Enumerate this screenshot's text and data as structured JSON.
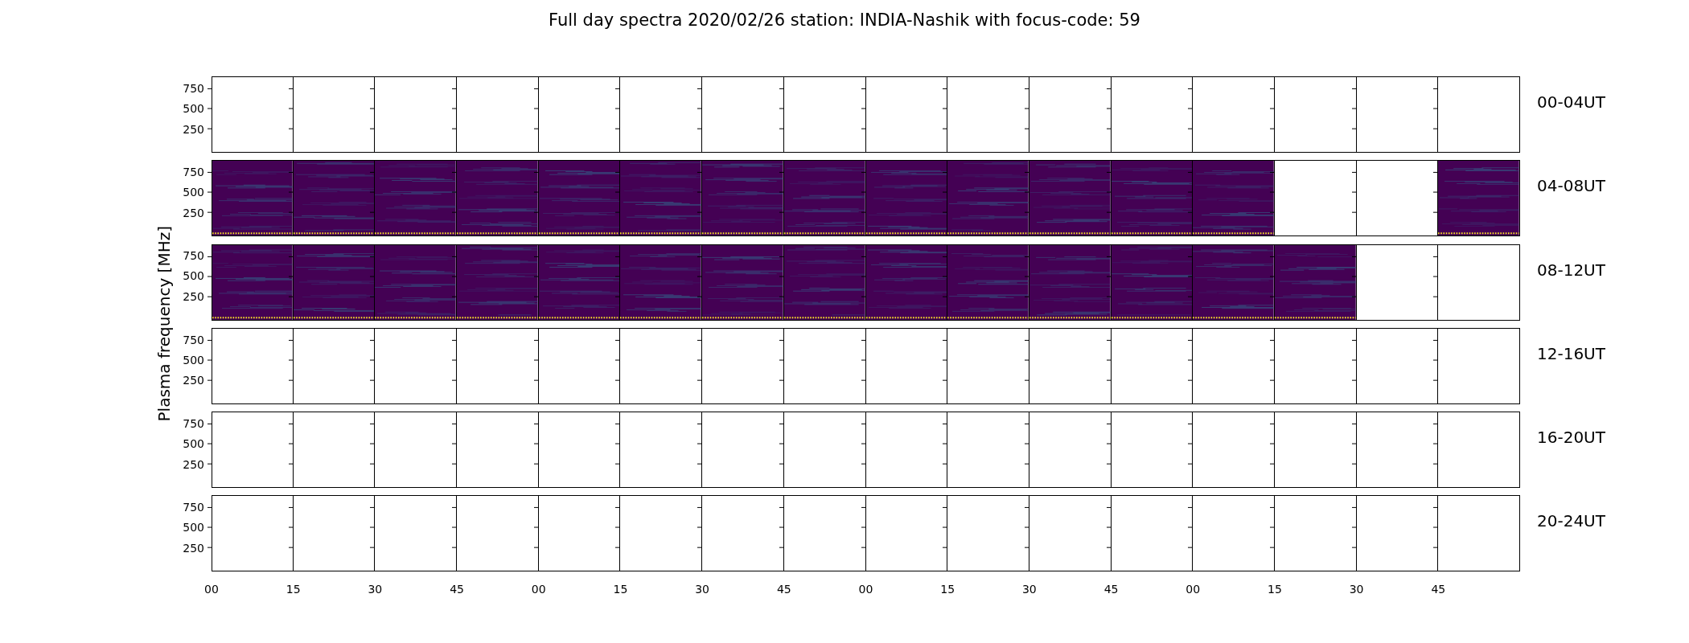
{
  "title": "Full day spectra 2020/02/26 station: INDIA-Nashik with focus-code: 59",
  "ylabel": "Plasma frequency [MHz]",
  "rows": [
    {
      "label": "00-04UT",
      "yticks": [
        "750",
        "500",
        "250"
      ],
      "panels": [
        {
          "has_data": false
        },
        {
          "has_data": false
        },
        {
          "has_data": false
        },
        {
          "has_data": false
        },
        {
          "has_data": false
        },
        {
          "has_data": false
        },
        {
          "has_data": false
        },
        {
          "has_data": false
        },
        {
          "has_data": false
        },
        {
          "has_data": false
        },
        {
          "has_data": false
        },
        {
          "has_data": false
        },
        {
          "has_data": false
        },
        {
          "has_data": false
        },
        {
          "has_data": false
        },
        {
          "has_data": false
        }
      ]
    },
    {
      "label": "04-08UT",
      "yticks": [
        "750",
        "500",
        "250"
      ],
      "panels": [
        {
          "has_data": true
        },
        {
          "has_data": true
        },
        {
          "has_data": true
        },
        {
          "has_data": true
        },
        {
          "has_data": true
        },
        {
          "has_data": true
        },
        {
          "has_data": true
        },
        {
          "has_data": true
        },
        {
          "has_data": true
        },
        {
          "has_data": true
        },
        {
          "has_data": true
        },
        {
          "has_data": true
        },
        {
          "has_data": true
        },
        {
          "has_data": false
        },
        {
          "has_data": false
        },
        {
          "has_data": true
        }
      ]
    },
    {
      "label": "08-12UT",
      "yticks": [
        "750",
        "500",
        "250"
      ],
      "panels": [
        {
          "has_data": true
        },
        {
          "has_data": true
        },
        {
          "has_data": true
        },
        {
          "has_data": true
        },
        {
          "has_data": true
        },
        {
          "has_data": true
        },
        {
          "has_data": true
        },
        {
          "has_data": true
        },
        {
          "has_data": true
        },
        {
          "has_data": true
        },
        {
          "has_data": true
        },
        {
          "has_data": true
        },
        {
          "has_data": true
        },
        {
          "has_data": true
        },
        {
          "has_data": false
        },
        {
          "has_data": false
        }
      ]
    },
    {
      "label": "12-16UT",
      "yticks": [
        "750",
        "500",
        "250"
      ],
      "panels": [
        {
          "has_data": false
        },
        {
          "has_data": false
        },
        {
          "has_data": false
        },
        {
          "has_data": false
        },
        {
          "has_data": false
        },
        {
          "has_data": false
        },
        {
          "has_data": false
        },
        {
          "has_data": false
        },
        {
          "has_data": false
        },
        {
          "has_data": false
        },
        {
          "has_data": false
        },
        {
          "has_data": false
        },
        {
          "has_data": false
        },
        {
          "has_data": false
        },
        {
          "has_data": false
        },
        {
          "has_data": false
        }
      ]
    },
    {
      "label": "16-20UT",
      "yticks": [
        "750",
        "500",
        "250"
      ],
      "panels": [
        {
          "has_data": false
        },
        {
          "has_data": false
        },
        {
          "has_data": false
        },
        {
          "has_data": false
        },
        {
          "has_data": false
        },
        {
          "has_data": false
        },
        {
          "has_data": false
        },
        {
          "has_data": false
        },
        {
          "has_data": false
        },
        {
          "has_data": false
        },
        {
          "has_data": false
        },
        {
          "has_data": false
        },
        {
          "has_data": false
        },
        {
          "has_data": false
        },
        {
          "has_data": false
        },
        {
          "has_data": false
        }
      ]
    },
    {
      "label": "20-24UT",
      "yticks": [
        "750",
        "500",
        "250"
      ],
      "panels": [
        {
          "has_data": false
        },
        {
          "has_data": false
        },
        {
          "has_data": false
        },
        {
          "has_data": false
        },
        {
          "has_data": false
        },
        {
          "has_data": false
        },
        {
          "has_data": false
        },
        {
          "has_data": false
        },
        {
          "has_data": false
        },
        {
          "has_data": false
        },
        {
          "has_data": false
        },
        {
          "has_data": false
        },
        {
          "has_data": false
        },
        {
          "has_data": false
        },
        {
          "has_data": false
        },
        {
          "has_data": false
        }
      ]
    }
  ],
  "xticks": [
    "00",
    "15",
    "30",
    "45",
    "00",
    "15",
    "30",
    "45",
    "00",
    "15",
    "30",
    "45",
    "00",
    "15",
    "30",
    "45"
  ]
}
